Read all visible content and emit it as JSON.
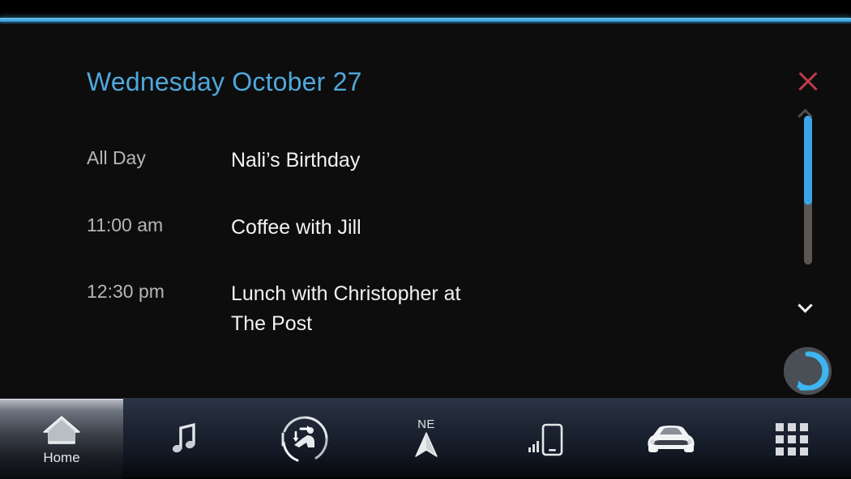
{
  "theme": {
    "accent_blue": "#4fb0e6",
    "title_blue": "#4fa8dc",
    "close_red": "#bf3a4c",
    "scroll_thumb": "#3aa5e8",
    "content_bg": "#0d0d0d"
  },
  "header": {
    "title": "Wednesday October 27"
  },
  "agenda": {
    "events": [
      {
        "time": "All Day",
        "title": "Nali’s Birthday"
      },
      {
        "time": "11:00 am",
        "title": "Coffee with Jill"
      },
      {
        "time": "12:30 pm",
        "title": "Lunch with Christopher at\n The Post"
      }
    ]
  },
  "right_rail": {
    "close_icon": "close-x-icon",
    "scroll_up_icon": "chevron-up-icon",
    "scroll_down_icon": "chevron-down-icon",
    "scroll_thumb_percent": 60,
    "assistant_icon": "alexa-ring-icon"
  },
  "bottom_nav": {
    "items": [
      {
        "icon": "home-icon",
        "label": "Home",
        "active": true
      },
      {
        "icon": "music-note-icon",
        "label": "",
        "active": false
      },
      {
        "icon": "climate-seat-icon",
        "label": "",
        "active": false
      },
      {
        "icon": "navigation-compass-icon",
        "label": "",
        "heading": "NE",
        "active": false
      },
      {
        "icon": "phone-signal-icon",
        "label": "",
        "active": false
      },
      {
        "icon": "vehicle-car-icon",
        "label": "",
        "active": false
      },
      {
        "icon": "apps-grid-icon",
        "label": "",
        "active": false
      }
    ]
  }
}
